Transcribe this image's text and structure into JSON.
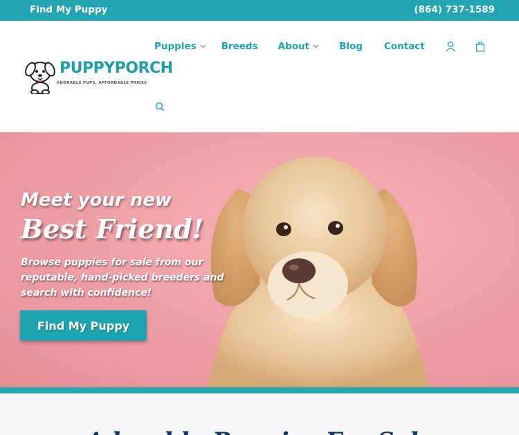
{
  "topbar": {
    "find_link": "Find My Puppy",
    "phone": "(864) 737-1589"
  },
  "logo": {
    "name_part1": "PUPPY",
    "name_part2": "PORCH",
    "tagline": "ADORABLE PUPS, AFFORDABLE PRICES"
  },
  "nav": {
    "items": [
      {
        "label": "Puppies",
        "has_dropdown": true
      },
      {
        "label": "Breeds",
        "has_dropdown": false
      },
      {
        "label": "About",
        "has_dropdown": true
      },
      {
        "label": "Blog",
        "has_dropdown": false
      },
      {
        "label": "Contact",
        "has_dropdown": false
      }
    ],
    "icons": [
      "user-icon",
      "shopping-bag-icon",
      "search-icon"
    ]
  },
  "hero": {
    "line1": "Meet your new",
    "line2": "Best Friend!",
    "description": "Browse puppies for sale from our reputable, hand-picked breeders and search with confidence!",
    "cta_label": "Find My Puppy"
  },
  "section": {
    "title": "Adorable Puppies For Sale"
  },
  "colors": {
    "teal": "#21a6b1",
    "hero_pink": "#ee9ea5",
    "navy": "#16355a"
  }
}
